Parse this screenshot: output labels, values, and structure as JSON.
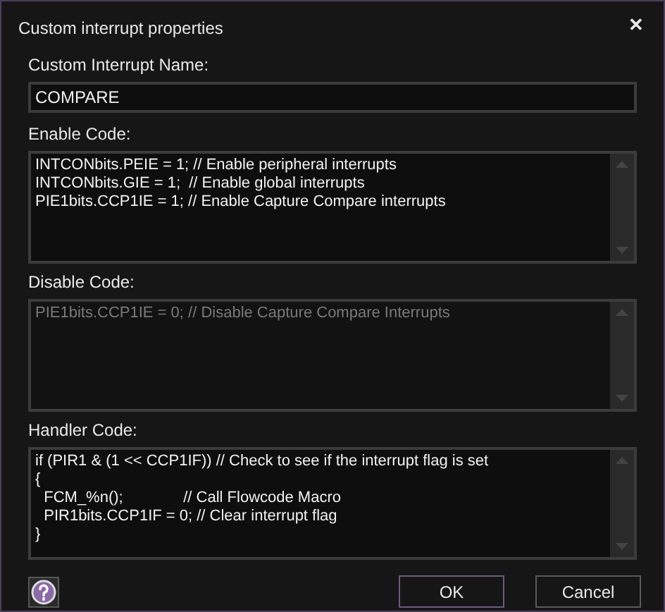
{
  "window": {
    "title": "Custom interrupt properties",
    "close": "✕"
  },
  "name_field": {
    "label": "Custom Interrupt Name:",
    "value": "COMPARE"
  },
  "code_sections": [
    {
      "label": "Enable Code:",
      "disabled": false,
      "lines": [
        "INTCONbits.PEIE = 1; // Enable peripheral interrupts",
        "INTCONbits.GIE = 1;  // Enable global interrupts",
        "PIE1bits.CCP1IE = 1; // Enable Capture Compare interrupts"
      ]
    },
    {
      "label": "Disable Code:",
      "disabled": true,
      "lines": [
        "PIE1bits.CCP1IE = 0; // Disable Capture Compare Interrupts"
      ]
    },
    {
      "label": "Handler Code:",
      "disabled": false,
      "lines": [
        "if (PIR1 & (1 << CCP1IF)) // Check to see if the interrupt flag is set",
        "{",
        "  FCM_%n();              // Call Flowcode Macro",
        "  PIR1bits.CCP1IF = 0; // Clear interrupt flag",
        "}"
      ]
    }
  ],
  "buttons": [
    {
      "label": "OK",
      "focused": true
    },
    {
      "label": "Cancel",
      "focused": false
    }
  ]
}
